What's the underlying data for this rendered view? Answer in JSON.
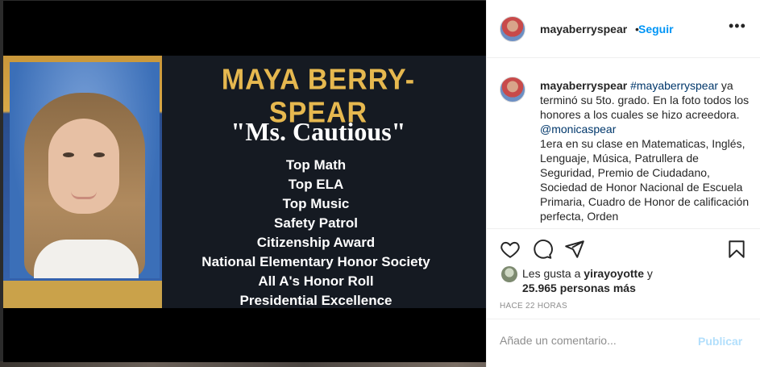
{
  "post": {
    "username": "mayaberryspear",
    "follow_label": "Seguir",
    "separator": "•",
    "more_label": "•••"
  },
  "image": {
    "name_text": "MAYA BERRY-SPEAR",
    "nickname_text": "\"Ms. Cautious\"",
    "honors": [
      "Top Math",
      "Top ELA",
      "Top Music",
      "Safety Patrol",
      "Citizenship Award",
      "National Elementary Honor Society",
      "All A's Honor Roll",
      "Presidential Excellence"
    ]
  },
  "caption": {
    "username": "mayaberryspear",
    "hashtag": "#mayaberryspear",
    "text1": "ya terminó su 5to. grado. En la foto todos los honores a los cuales se hizo acreedora.",
    "mention": "@monicaspear",
    "text2": "1era en su clase en Matematicas, Inglés, Lenguaje, Música, Patrullera de Seguridad, Premio de Ciudadano, Sociedad de Honor Nacional de Escuela Primaria, Cuadro de Honor de calificación perfecta, Orden"
  },
  "likes": {
    "prefix": "Les gusta a",
    "user": "yirayoyotte",
    "conjunction": "y",
    "count": "25.965 personas más"
  },
  "timestamp": "HACE 22 HORAS",
  "comment": {
    "placeholder": "Añade un comentario...",
    "publish_label": "Publicar"
  },
  "icons": {
    "like": "heart-icon",
    "comment": "comment-icon",
    "share": "share-icon",
    "save": "bookmark-icon"
  }
}
